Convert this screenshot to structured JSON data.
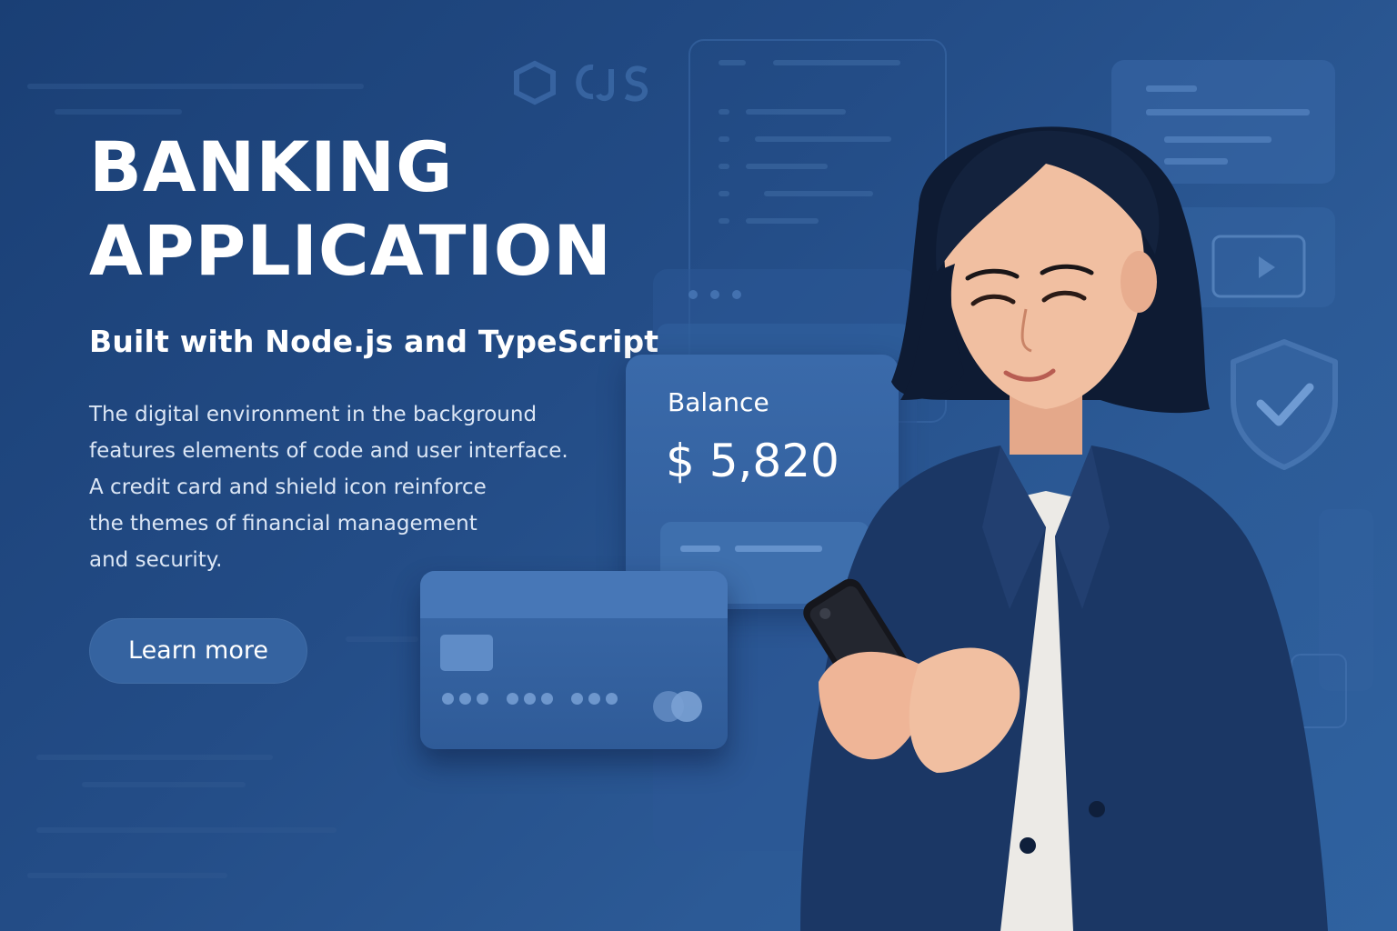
{
  "hero": {
    "title_line1": "BANKING",
    "title_line2": "APPLICATION",
    "subtitle": "Built with Node.js and TypeScript",
    "description_lines": [
      "The digital environment in the background",
      "features elements of code and user interface.",
      "A credit card and shield icon reinforce",
      "the themes of financial management",
      "and security."
    ],
    "cta_label": "Learn more"
  },
  "balance_card": {
    "label": "Balance",
    "amount": "$ 5,820"
  },
  "icons": {
    "shield": "shield-check-icon",
    "credit_card": "credit-card",
    "nodejs": "nodejs-logo-icon",
    "play": "play-icon"
  },
  "colors": {
    "background": "#234c86",
    "panel": "#3a6aaa",
    "button": "#3563a0",
    "text": "#ffffff"
  }
}
